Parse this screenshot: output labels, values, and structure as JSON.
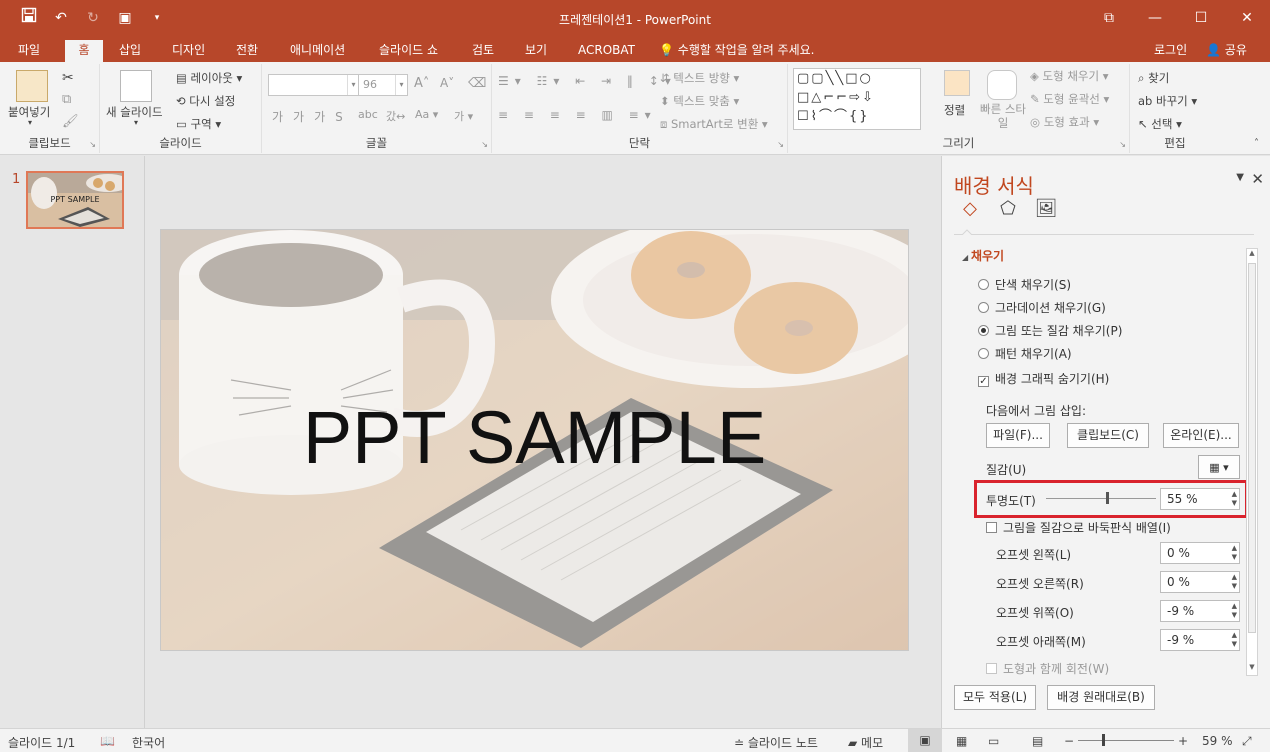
{
  "window": {
    "title": "프레젠테이션1 - PowerPoint"
  },
  "tabs": [
    "파일",
    "홈",
    "삽입",
    "디자인",
    "전환",
    "애니메이션",
    "슬라이드 쇼",
    "검토",
    "보기",
    "ACROBAT"
  ],
  "tell_me": "수행할 작업을 알려 주세요.",
  "login": "로그인",
  "share": "공유",
  "ribbon": {
    "clipboard": {
      "paste": "붙여넣기",
      "label": "클립보드"
    },
    "slides": {
      "new_slide": "새 슬라이드",
      "layout": "레이아웃",
      "reset": "다시 설정",
      "section": "구역",
      "label": "슬라이드"
    },
    "font": {
      "size": "96",
      "label": "글꼴"
    },
    "paragraph": {
      "text_direction": "텍스트 방향",
      "align_text": "텍스트 맞춤",
      "smartart": "SmartArt로 변환",
      "label": "단락"
    },
    "drawing": {
      "arrange": "정렬",
      "quick_styles": "빠른 스타일",
      "shape_fill": "도형 채우기",
      "shape_outline": "도형 윤곽선",
      "shape_effects": "도형 효과",
      "label": "그리기"
    },
    "editing": {
      "find": "찾기",
      "replace": "바꾸기",
      "select": "선택",
      "label": "편집"
    }
  },
  "thumbnails": [
    {
      "number": "1",
      "title": "PPT SAMPLE"
    }
  ],
  "slide": {
    "title": "PPT SAMPLE"
  },
  "format_pane": {
    "title": "배경 서식",
    "fill_section": "채우기",
    "fill_options": [
      "단색 채우기(S)",
      "그라데이션 채우기(G)",
      "그림 또는 질감 채우기(P)",
      "패턴 채우기(A)"
    ],
    "selected_fill": 2,
    "hide_graphics": "배경 그래픽 숨기기(H)",
    "insert_from": "다음에서 그림 삽입:",
    "file_btn": "파일(F)...",
    "clipboard_btn": "클립보드(C)",
    "online_btn": "온라인(E)...",
    "texture": "질감(U)",
    "transparency_label": "투명도(T)",
    "transparency_value": "55 %",
    "transparency_fraction": 0.55,
    "tile": "그림을 질감으로 바둑판식 배열(I)",
    "offsets": [
      {
        "label": "오프셋 왼쪽(L)",
        "value": "0 %"
      },
      {
        "label": "오프셋 오른쪽(R)",
        "value": "0 %"
      },
      {
        "label": "오프셋 위쪽(O)",
        "value": "-9 %"
      },
      {
        "label": "오프셋 아래쪽(M)",
        "value": "-9 %"
      }
    ],
    "rotate": "도형과 함께 회전(W)",
    "apply_all": "모두 적용(L)",
    "reset_bg": "배경 원래대로(B)"
  },
  "status": {
    "slide": "슬라이드 1/1",
    "language": "한국어",
    "notes": "슬라이드 노트",
    "comments": "메모",
    "zoom": "59 %"
  },
  "colors": {
    "accent": "#b7472a",
    "highlight": "#d9232d"
  }
}
